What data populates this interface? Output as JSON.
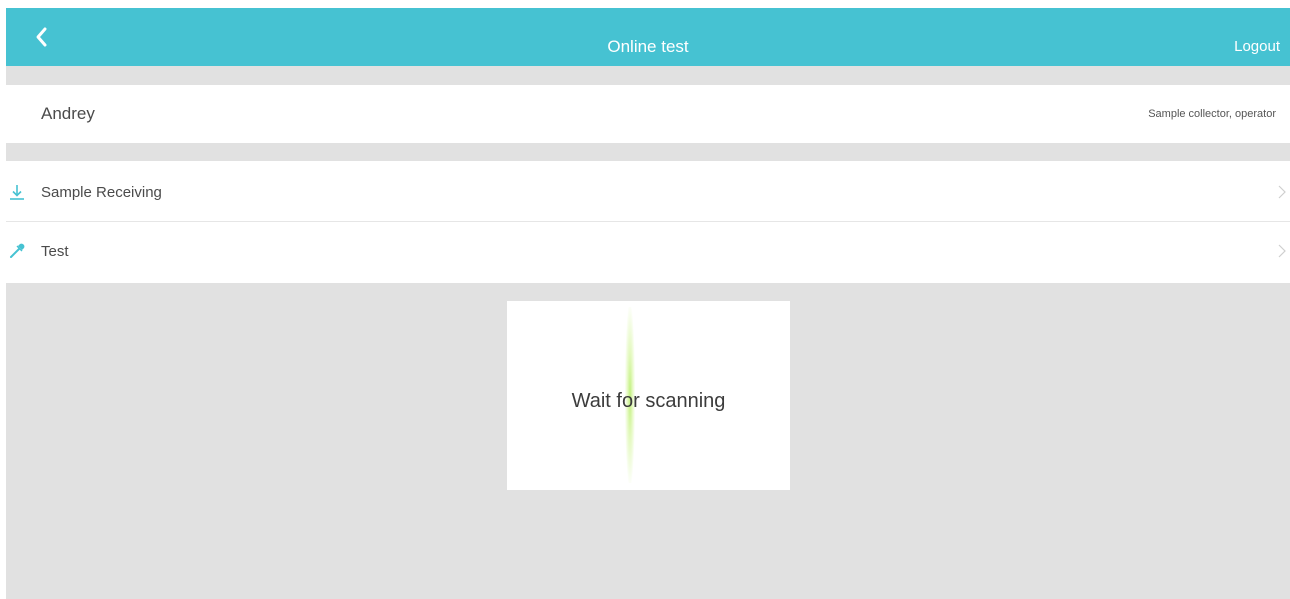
{
  "header": {
    "title": "Online test",
    "back_icon": "chevron-left-icon",
    "logout_label": "Logout",
    "background_color": "#46c2d2"
  },
  "user": {
    "name": "Andrey",
    "role": "Sample collector, operator"
  },
  "menu": {
    "items": [
      {
        "label": "Sample Receiving",
        "icon": "download-icon"
      },
      {
        "label": "Test",
        "icon": "dropper-icon"
      }
    ],
    "chevron_icon": "chevron-right-icon",
    "icon_color": "#46c2d2"
  },
  "scanner": {
    "status_text": "Wait for scanning",
    "scan_line_color": "#bef078"
  }
}
